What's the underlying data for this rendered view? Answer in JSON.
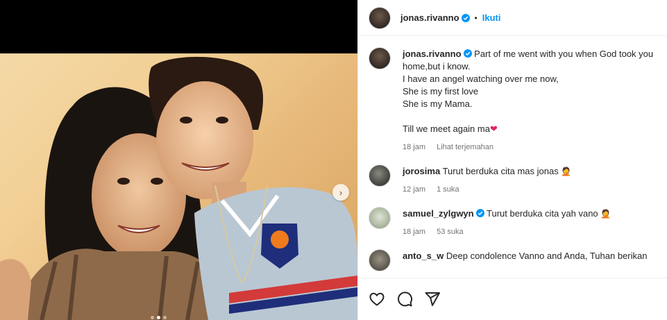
{
  "post": {
    "username": "jonas.rivanno",
    "follow_label": "Ikuti",
    "separator": "•",
    "carousel": {
      "current": 2,
      "total": 3
    }
  },
  "caption": {
    "username": "jonas.rivanno",
    "lines": [
      "Part of me went with you when God took you home,but i know.",
      "I have an angel watching over me now,",
      "She is my first love",
      "She is my Mama.",
      "",
      "Till we meet again ma"
    ],
    "heart": "❤",
    "time": "18 jam",
    "translate": "Lihat terjemahan"
  },
  "comments": [
    {
      "username": "jorosima",
      "verified": false,
      "text": "Turut berduka cita mas jonas",
      "emoji": "🤦",
      "time": "12 jam",
      "likes": "1 suka"
    },
    {
      "username": "samuel_zylgwyn",
      "verified": true,
      "text": "Turut berduka cita yah vano",
      "emoji": "🤦",
      "time": "18 jam",
      "likes": "53 suka"
    },
    {
      "username": "anto_s_w",
      "verified": false,
      "text": "Deep condolence Vanno and Anda, Tuhan berikan",
      "emoji": "",
      "time": "",
      "likes": ""
    }
  ],
  "icons": {
    "like": "heart-icon",
    "comment": "comment-icon",
    "share": "share-icon",
    "verified": "verified-badge-icon",
    "next": "chevron-right-icon"
  },
  "colors": {
    "accent": "#0095f6",
    "text": "#262626",
    "muted": "#737373",
    "heart": "#e0245e"
  }
}
